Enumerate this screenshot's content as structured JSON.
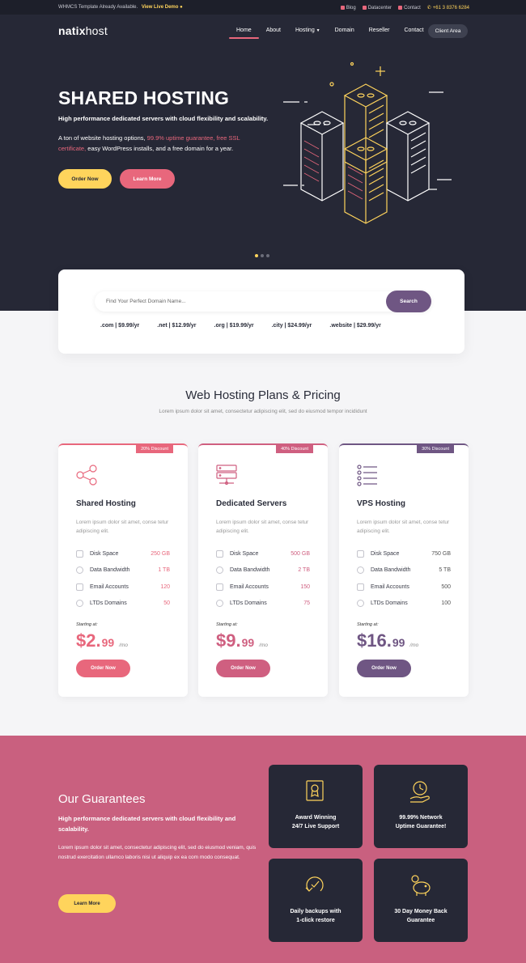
{
  "topbar": {
    "notice": "WHMCS Template Already Available.",
    "demo_link": "View Live Demo",
    "links": {
      "blog": "Blog",
      "datacenter": "Datacenter",
      "contact": "Contact"
    },
    "phone": "+61 3 8376 6284"
  },
  "header": {
    "logo_bold": "natix",
    "logo_light": "host",
    "nav": [
      "Home",
      "About",
      "Hosting",
      "Domain",
      "Reseller",
      "Contact"
    ],
    "client_area": "Client Area"
  },
  "hero": {
    "title": "SHARED HOSTING",
    "subtitle": "High performance dedicated servers with cloud flexibility and scalability.",
    "desc_before": "A ton of website hosting options, ",
    "desc_highlight": "99.9% uptime guarantee, free SSL certificate,",
    "desc_after": " easy WordPress installs, and a free domain for a year.",
    "order_btn": "Order Now",
    "learn_btn": "Learn More"
  },
  "domain": {
    "placeholder": "Find Your Perfect Domain Name...",
    "search_btn": "Search",
    "tlds": [
      ".com | $9.99/yr",
      ".net | $12.99/yr",
      ".org | $19.99/yr",
      ".city | $24.99/yr",
      ".website | $29.99/yr"
    ]
  },
  "plans_section": {
    "title": "Web Hosting Plans & Pricing",
    "subtitle": "Lorem ipsum dolor sit amet, consectetur adipiscing elit, sed do eiusmod tempor incididunt"
  },
  "plans": [
    {
      "discount": "20% Discount",
      "name": "Shared Hosting",
      "desc": "Lorem ipsum dolor sit amet, conse tetur adipiscing elit.",
      "features": [
        {
          "label": "Disk Space",
          "value": "250 GB"
        },
        {
          "label": "Data Bandwidth",
          "value": "1 TB"
        },
        {
          "label": "Email Accounts",
          "value": "120"
        },
        {
          "label": "LTDs Domains",
          "value": "50"
        }
      ],
      "starting": "Starting at:",
      "price_main": "$2.",
      "price_cents": "99",
      "per": "/mo",
      "button": "Order Now"
    },
    {
      "discount": "40% Discount",
      "name": "Dedicated Servers",
      "desc": "Lorem ipsum dolor sit amet, conse tetur adipiscing elit.",
      "features": [
        {
          "label": "Disk Space",
          "value": "500 GB"
        },
        {
          "label": "Data Bandwidth",
          "value": "2 TB"
        },
        {
          "label": "Email Accounts",
          "value": "150"
        },
        {
          "label": "LTDs Domains",
          "value": "75"
        }
      ],
      "starting": "Starting at:",
      "price_main": "$9.",
      "price_cents": "99",
      "per": "/mo",
      "button": "Order Now"
    },
    {
      "discount": "30% Discount",
      "name": "VPS Hosting",
      "desc": "Lorem ipsum dolor sit amet, conse tetur adipiscing elit.",
      "features": [
        {
          "label": "Disk Space",
          "value": "750 GB"
        },
        {
          "label": "Data Bandwidth",
          "value": "5 TB"
        },
        {
          "label": "Email Accounts",
          "value": "500"
        },
        {
          "label": "LTDs Domains",
          "value": "100"
        }
      ],
      "starting": "Starting at:",
      "price_main": "$16.",
      "price_cents": "99",
      "per": "/mo",
      "button": "Order Now"
    }
  ],
  "guarantees": {
    "title": "Our Guarantees",
    "subtitle": "High performance dedicated servers with cloud flexibility and scalability.",
    "desc": "Lorem ipsum dolor sit amet, consectetur adipiscing elit, sed do eiusmod veniam, quis nostrud exercitation ullamco laboris nisi ut aliquip ex ea com modo consequat.",
    "button": "Learn More",
    "cards": [
      {
        "line1": "Award Winning",
        "line2": "24/7 Live Support",
        "icon": "award-certificate-icon"
      },
      {
        "line1": "99.99% Network",
        "line2": "Uptime Guarantee!",
        "icon": "clock-hand-icon"
      },
      {
        "line1": "Daily backups with",
        "line2": "1-click restore",
        "icon": "backup-restore-icon"
      },
      {
        "line1": "30 Day Money Back",
        "line2": "Guarantee",
        "icon": "piggy-bank-icon"
      }
    ]
  },
  "colors": {
    "dark": "#262836",
    "pink": "#e8677c",
    "rose": "#cf5f80",
    "purple": "#6f5683",
    "yellow": "#ffd45c",
    "guarantee_bg": "#c9607f"
  }
}
